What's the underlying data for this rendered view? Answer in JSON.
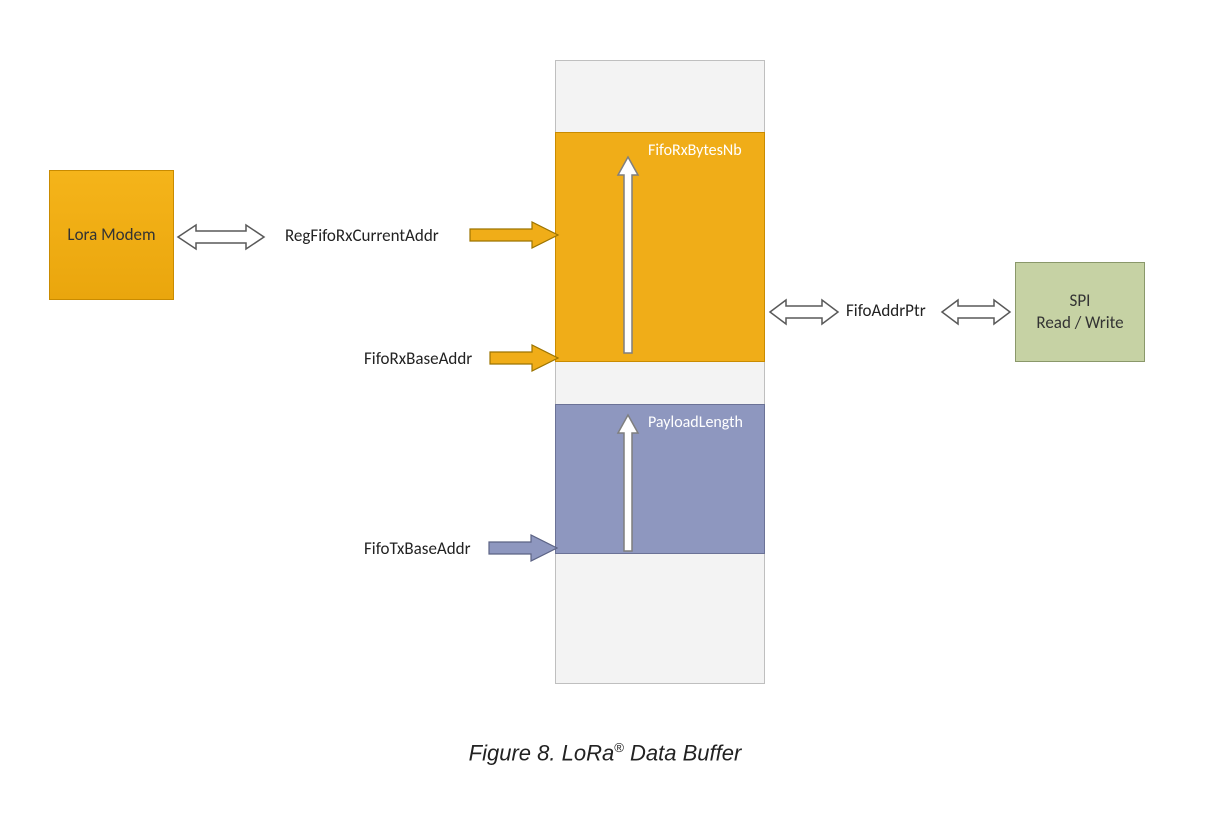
{
  "caption_prefix": "Figure 8.   LoRa",
  "caption_reg": "®",
  "caption_suffix": " Data Buffer",
  "modem_label": "Lora Modem",
  "spi_line1": "SPI",
  "spi_line2": "Read / Write",
  "buffer": {
    "rx_label": "FifoRxBytesNb",
    "tx_label": "PayloadLength"
  },
  "pointers": {
    "rx_current": "RegFifoRxCurrentAddr",
    "rx_base": "FifoRxBaseAddr",
    "tx_base": "FifoTxBaseAddr",
    "addr_ptr": "FifoAddrPtr"
  },
  "colors": {
    "orange": "#f0ad18",
    "blue": "#8e97bf",
    "green": "#c6d2a4",
    "grey": "#f3f3f3",
    "outline": "#595959"
  }
}
